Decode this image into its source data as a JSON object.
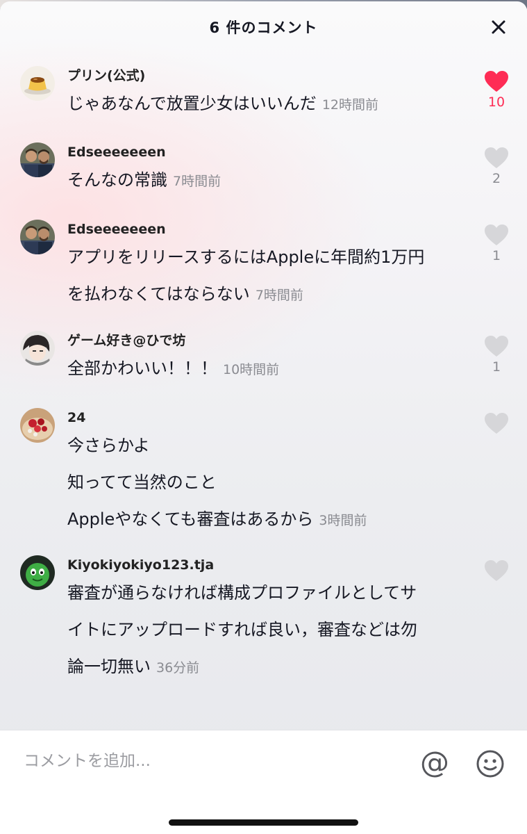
{
  "header": {
    "title": "6 件のコメント"
  },
  "comments": [
    {
      "username": "プリン(公式)",
      "lines": [
        "じゃあなんで放置少女はいいんだ"
      ],
      "time": "12時間前",
      "likes": "10",
      "liked": true,
      "avatar": "pudding-avatar"
    },
    {
      "username": "Edseeeeeeen",
      "lines": [
        "そんなの常識"
      ],
      "time": "7時間前",
      "likes": "2",
      "liked": false,
      "avatar": "two-men-avatar"
    },
    {
      "username": "Edseeeeeeen",
      "lines": [
        "アプリをリリースするにはAppleに年間約1万円",
        "を払わなくてはならない"
      ],
      "time": "7時間前",
      "likes": "1",
      "liked": false,
      "avatar": "two-men-avatar"
    },
    {
      "username": "ゲーム好き@ひで坊",
      "lines": [
        "全部かわいい！！！"
      ],
      "time": "10時間前",
      "likes": "1",
      "liked": false,
      "avatar": "anime-character-avatar"
    },
    {
      "username": "24",
      "lines": [
        "今さらかよ",
        "知ってて当然のこと",
        "Appleやなくても審査はあるから"
      ],
      "time": "3時間前",
      "likes": "",
      "liked": false,
      "avatar": "dessert-avatar"
    },
    {
      "username": "Kiyokiyokiyo123.tja",
      "lines": [
        "審査が通らなければ構成プロファイルとしてサ",
        "イトにアップロードすれば良い，審査などは勿",
        "論一切無い"
      ],
      "time": "36分前",
      "likes": "",
      "liked": false,
      "avatar": "green-character-avatar"
    }
  ],
  "footer": {
    "placeholder": "コメントを追加...",
    "at_symbol": "@",
    "at_icon": "at-mention-icon",
    "emoji_icon": "smiley-face-icon"
  },
  "colors": {
    "like_active": "#fe2c55",
    "like_inactive": "#d6d6d9",
    "meta_gray": "#8a8b91",
    "text_primary": "#161823"
  }
}
